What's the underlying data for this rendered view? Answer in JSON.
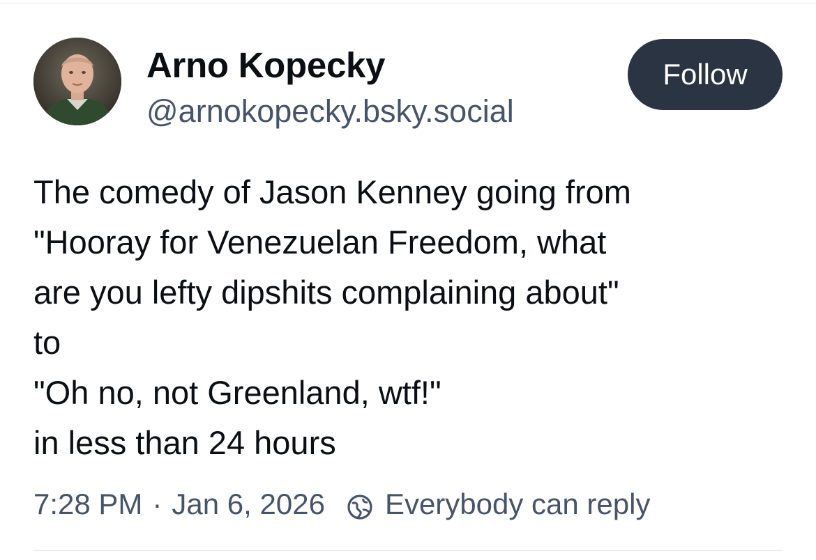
{
  "post": {
    "author": {
      "display_name": "Arno Kopecky",
      "handle": "@arnokopecky.bsky.social"
    },
    "follow_label": "Follow",
    "text_lines": [
      "The comedy of Jason Kenney going from",
      "\"Hooray for Venezuelan Freedom, what",
      "are you lefty dipshits complaining about\"",
      "to",
      "\"Oh no, not Greenland, wtf!\"",
      "in less than 24 hours"
    ],
    "time": "7:28 PM",
    "separator": "·",
    "date": "Jan 6, 2026",
    "reply_setting": "Everybody can reply"
  },
  "icons": {
    "avatar": "avatar-photo",
    "reply_setting": "earth-icon"
  },
  "colors": {
    "text": "#0b0f14",
    "secondary_text": "#475467",
    "follow_button_bg": "#2a3442",
    "follow_button_text": "#ffffff",
    "divider": "#e6e9ed"
  }
}
